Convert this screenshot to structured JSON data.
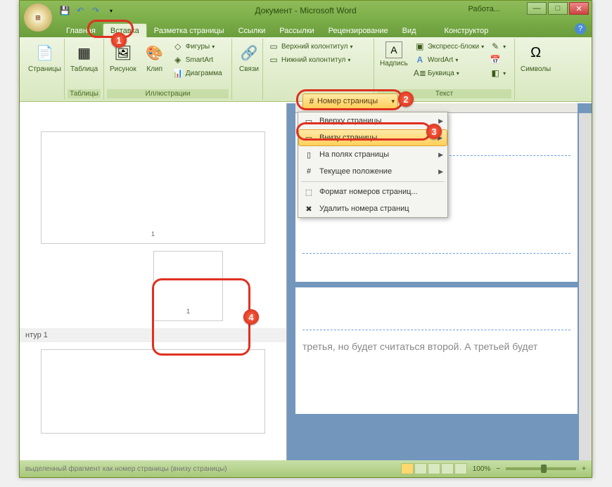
{
  "title": "Документ - Microsoft Word",
  "work_tab": "Работа...",
  "tabs": [
    "Главная",
    "Вставка",
    "Разметка страницы",
    "Ссылки",
    "Рассылки",
    "Рецензирование",
    "Вид",
    "Конструктор"
  ],
  "active_tab_index": 1,
  "ribbon": {
    "pages": {
      "label": "Страницы",
      "btn": "Страницы"
    },
    "tables": {
      "label": "Таблицы",
      "btn": "Таблица"
    },
    "illustrations": {
      "label": "Иллюстрации",
      "pic": "Рисунок",
      "clip": "Клип",
      "shapes": "Фигуры",
      "smartart": "SmartArt",
      "chart": "Диаграмма"
    },
    "links": {
      "label": "Связи",
      "btn": "Связи"
    },
    "headerfooter": {
      "header": "Верхний колонтитул",
      "footer": "Нижний колонтитул",
      "pagenum": "Номер страницы"
    },
    "text": {
      "label": "Текст",
      "textbox": "Надпись",
      "quick": "Экспресс-блоки",
      "wordart": "WordArt",
      "dropcap": "Буквица"
    },
    "symbols": {
      "label": "Символы",
      "btn": "Символы"
    }
  },
  "menu": {
    "top": "Вверху страницы",
    "bottom": "Внизу страницы",
    "margins": "На полях страницы",
    "current": "Текущее положение",
    "format": "Формат номеров страниц...",
    "remove": "Удалить номера страниц"
  },
  "gallery": {
    "title": "нтур 1",
    "preview_num": "1"
  },
  "doc_text": "третья, но будет считаться второй. А третьей будет",
  "status": {
    "desc": "выделенный фрагмент как номер страницы (внизу страницы)",
    "zoom": "100%"
  },
  "callout_badges": [
    "1",
    "2",
    "3",
    "4"
  ]
}
